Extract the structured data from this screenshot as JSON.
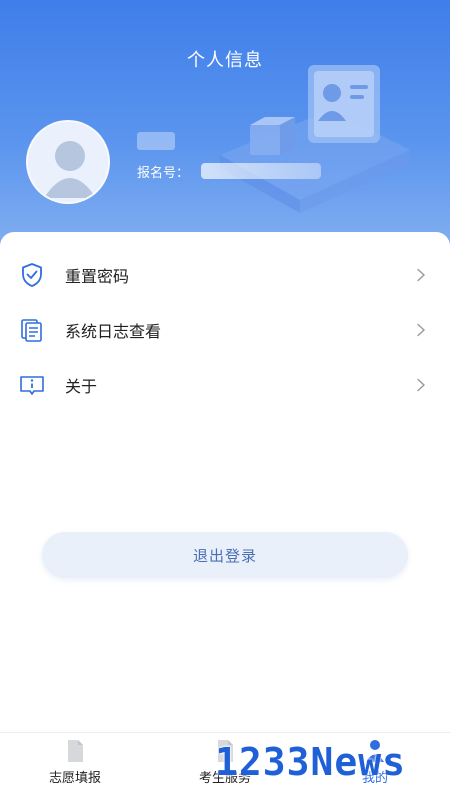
{
  "header": {
    "title": "个人信息",
    "user_name": "",
    "reg_label": "报名号：",
    "reg_value": ""
  },
  "menu": {
    "items": [
      {
        "label": "重置密码",
        "icon": "shield-check-icon"
      },
      {
        "label": "系统日志查看",
        "icon": "document-list-icon"
      },
      {
        "label": "关于",
        "icon": "info-card-icon"
      }
    ]
  },
  "logout_label": "退出登录",
  "tabbar": {
    "tabs": [
      {
        "label": "志愿填报",
        "icon": "document-icon",
        "active": false
      },
      {
        "label": "考生服务",
        "icon": "document-icon",
        "active": false
      },
      {
        "label": "我的",
        "icon": "person-icon",
        "active": true
      }
    ]
  },
  "watermark": "1233News",
  "colors": {
    "header_top": "#3f7eea",
    "accent": "#2f6de0",
    "logout_bg": "#e9f0fa",
    "logout_text": "#4a6fb5"
  }
}
